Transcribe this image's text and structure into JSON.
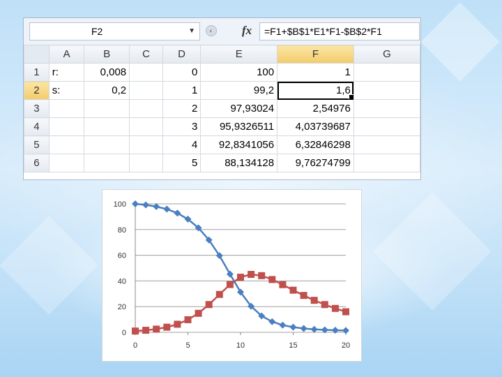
{
  "formula_bar": {
    "name_box": "F2",
    "fx_label": "fx",
    "formula": "=F1+$B$1*E1*F1-$B$2*F1"
  },
  "columns": [
    "A",
    "B",
    "C",
    "D",
    "E",
    "F",
    "G"
  ],
  "selected_column": "F",
  "selected_row": "2",
  "rows": [
    {
      "n": "1",
      "A": "r:",
      "B": "0,008",
      "C": "",
      "D": "0",
      "E": "100",
      "F": "1",
      "G": ""
    },
    {
      "n": "2",
      "A": "s:",
      "B": "0,2",
      "C": "",
      "D": "1",
      "E": "99,2",
      "F": "1,6",
      "G": ""
    },
    {
      "n": "3",
      "A": "",
      "B": "",
      "C": "",
      "D": "2",
      "E": "97,93024",
      "F": "2,54976",
      "G": ""
    },
    {
      "n": "4",
      "A": "",
      "B": "",
      "C": "",
      "D": "3",
      "E": "95,9326511",
      "F": "4,03739687",
      "G": ""
    },
    {
      "n": "5",
      "A": "",
      "B": "",
      "C": "",
      "D": "4",
      "E": "92,8341056",
      "F": "6,32846298",
      "G": ""
    },
    {
      "n": "6",
      "A": "",
      "B": "",
      "C": "",
      "D": "5",
      "E": "88,134128",
      "F": "9,76274799",
      "G": ""
    }
  ],
  "colors": {
    "series_blue": "#4a7fc0",
    "series_red": "#c0504d",
    "grid": "#a0a0a0"
  },
  "chart_data": {
    "type": "line",
    "xlim": [
      0,
      20
    ],
    "ylim": [
      0,
      100
    ],
    "x_ticks": [
      "0",
      "5",
      "10",
      "15",
      "20"
    ],
    "y_ticks": [
      "0",
      "20",
      "40",
      "60",
      "80",
      "100"
    ],
    "grid": "horizontal",
    "x": [
      0,
      1,
      2,
      3,
      4,
      5,
      6,
      7,
      8,
      9,
      10,
      11,
      12,
      13,
      14,
      15,
      16,
      17,
      18,
      19,
      20
    ],
    "series": [
      {
        "marker": "diamond",
        "color": "#4a7fc0",
        "values": [
          100,
          99.2,
          97.9,
          95.9,
          92.8,
          88.1,
          81.3,
          71.9,
          59.7,
          45.3,
          31.3,
          20.3,
          12.8,
          8.3,
          5.6,
          4.0,
          3.0,
          2.3,
          1.9,
          1.6,
          1.4
        ]
      },
      {
        "marker": "square",
        "color": "#c0504d",
        "values": [
          1,
          1.6,
          2.5,
          4.0,
          6.3,
          9.8,
          14.8,
          21.6,
          29.5,
          37.2,
          42.9,
          45.1,
          44.1,
          41.1,
          37.1,
          32.8,
          28.7,
          24.9,
          21.6,
          18.6,
          16.0
        ]
      }
    ]
  }
}
